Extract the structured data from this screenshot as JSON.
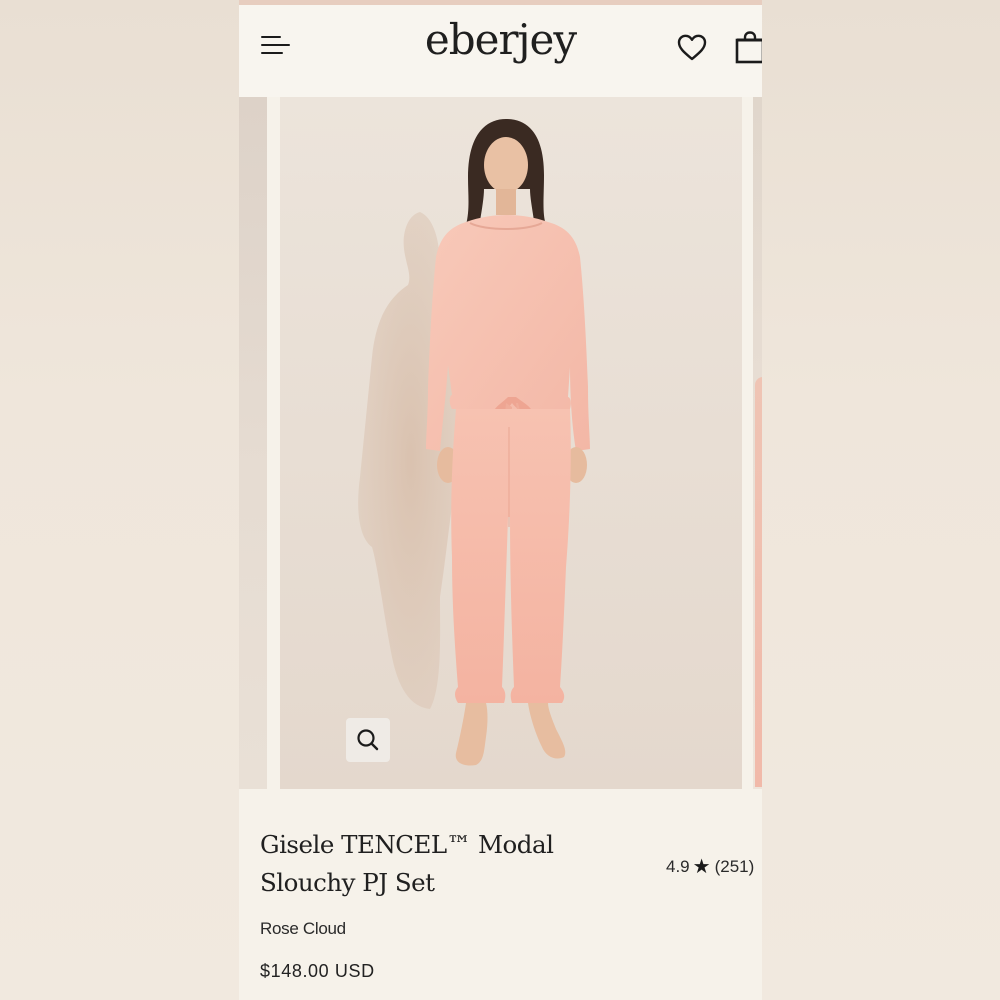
{
  "header": {
    "logo_text": "eberjey",
    "menu_icon": "hamburger-menu-icon",
    "wishlist_icon": "heart-icon",
    "bag_icon": "shopping-bag-icon"
  },
  "gallery": {
    "zoom_icon": "magnifier-icon"
  },
  "product": {
    "title": "Gisele TENCEL™ Modal Slouchy PJ Set",
    "rating_value": "4.9",
    "rating_star": "★",
    "rating_count": "(251)",
    "color_name": "Rose Cloud",
    "price": "$148.00 USD"
  },
  "colors": {
    "background": "#f6f2ea",
    "text": "#202020",
    "garment": "#f6bfae"
  }
}
